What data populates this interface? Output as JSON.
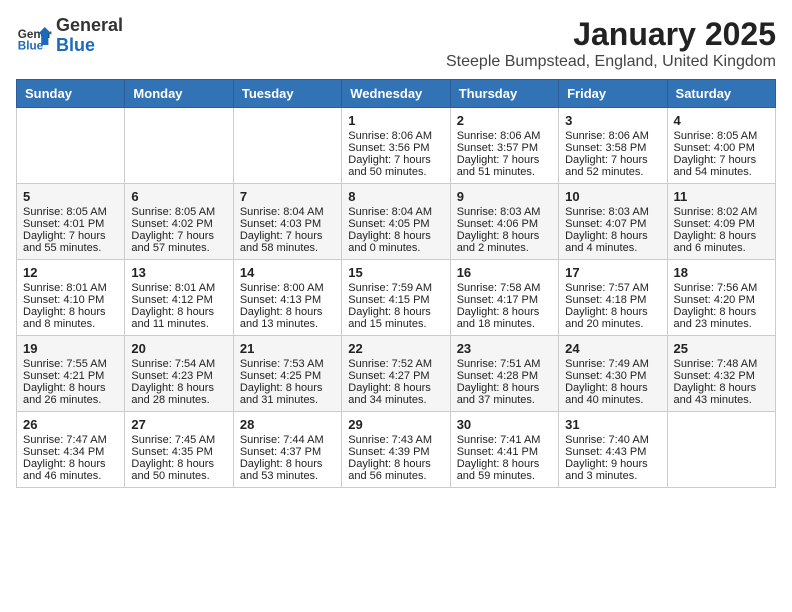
{
  "header": {
    "logo_general": "General",
    "logo_blue": "Blue",
    "month_title": "January 2025",
    "location": "Steeple Bumpstead, England, United Kingdom"
  },
  "weekdays": [
    "Sunday",
    "Monday",
    "Tuesday",
    "Wednesday",
    "Thursday",
    "Friday",
    "Saturday"
  ],
  "weeks": [
    [
      {
        "day": "",
        "info": ""
      },
      {
        "day": "",
        "info": ""
      },
      {
        "day": "",
        "info": ""
      },
      {
        "day": "1",
        "info": "Sunrise: 8:06 AM\nSunset: 3:56 PM\nDaylight: 7 hours and 50 minutes."
      },
      {
        "day": "2",
        "info": "Sunrise: 8:06 AM\nSunset: 3:57 PM\nDaylight: 7 hours and 51 minutes."
      },
      {
        "day": "3",
        "info": "Sunrise: 8:06 AM\nSunset: 3:58 PM\nDaylight: 7 hours and 52 minutes."
      },
      {
        "day": "4",
        "info": "Sunrise: 8:05 AM\nSunset: 4:00 PM\nDaylight: 7 hours and 54 minutes."
      }
    ],
    [
      {
        "day": "5",
        "info": "Sunrise: 8:05 AM\nSunset: 4:01 PM\nDaylight: 7 hours and 55 minutes."
      },
      {
        "day": "6",
        "info": "Sunrise: 8:05 AM\nSunset: 4:02 PM\nDaylight: 7 hours and 57 minutes."
      },
      {
        "day": "7",
        "info": "Sunrise: 8:04 AM\nSunset: 4:03 PM\nDaylight: 7 hours and 58 minutes."
      },
      {
        "day": "8",
        "info": "Sunrise: 8:04 AM\nSunset: 4:05 PM\nDaylight: 8 hours and 0 minutes."
      },
      {
        "day": "9",
        "info": "Sunrise: 8:03 AM\nSunset: 4:06 PM\nDaylight: 8 hours and 2 minutes."
      },
      {
        "day": "10",
        "info": "Sunrise: 8:03 AM\nSunset: 4:07 PM\nDaylight: 8 hours and 4 minutes."
      },
      {
        "day": "11",
        "info": "Sunrise: 8:02 AM\nSunset: 4:09 PM\nDaylight: 8 hours and 6 minutes."
      }
    ],
    [
      {
        "day": "12",
        "info": "Sunrise: 8:01 AM\nSunset: 4:10 PM\nDaylight: 8 hours and 8 minutes."
      },
      {
        "day": "13",
        "info": "Sunrise: 8:01 AM\nSunset: 4:12 PM\nDaylight: 8 hours and 11 minutes."
      },
      {
        "day": "14",
        "info": "Sunrise: 8:00 AM\nSunset: 4:13 PM\nDaylight: 8 hours and 13 minutes."
      },
      {
        "day": "15",
        "info": "Sunrise: 7:59 AM\nSunset: 4:15 PM\nDaylight: 8 hours and 15 minutes."
      },
      {
        "day": "16",
        "info": "Sunrise: 7:58 AM\nSunset: 4:17 PM\nDaylight: 8 hours and 18 minutes."
      },
      {
        "day": "17",
        "info": "Sunrise: 7:57 AM\nSunset: 4:18 PM\nDaylight: 8 hours and 20 minutes."
      },
      {
        "day": "18",
        "info": "Sunrise: 7:56 AM\nSunset: 4:20 PM\nDaylight: 8 hours and 23 minutes."
      }
    ],
    [
      {
        "day": "19",
        "info": "Sunrise: 7:55 AM\nSunset: 4:21 PM\nDaylight: 8 hours and 26 minutes."
      },
      {
        "day": "20",
        "info": "Sunrise: 7:54 AM\nSunset: 4:23 PM\nDaylight: 8 hours and 28 minutes."
      },
      {
        "day": "21",
        "info": "Sunrise: 7:53 AM\nSunset: 4:25 PM\nDaylight: 8 hours and 31 minutes."
      },
      {
        "day": "22",
        "info": "Sunrise: 7:52 AM\nSunset: 4:27 PM\nDaylight: 8 hours and 34 minutes."
      },
      {
        "day": "23",
        "info": "Sunrise: 7:51 AM\nSunset: 4:28 PM\nDaylight: 8 hours and 37 minutes."
      },
      {
        "day": "24",
        "info": "Sunrise: 7:49 AM\nSunset: 4:30 PM\nDaylight: 8 hours and 40 minutes."
      },
      {
        "day": "25",
        "info": "Sunrise: 7:48 AM\nSunset: 4:32 PM\nDaylight: 8 hours and 43 minutes."
      }
    ],
    [
      {
        "day": "26",
        "info": "Sunrise: 7:47 AM\nSunset: 4:34 PM\nDaylight: 8 hours and 46 minutes."
      },
      {
        "day": "27",
        "info": "Sunrise: 7:45 AM\nSunset: 4:35 PM\nDaylight: 8 hours and 50 minutes."
      },
      {
        "day": "28",
        "info": "Sunrise: 7:44 AM\nSunset: 4:37 PM\nDaylight: 8 hours and 53 minutes."
      },
      {
        "day": "29",
        "info": "Sunrise: 7:43 AM\nSunset: 4:39 PM\nDaylight: 8 hours and 56 minutes."
      },
      {
        "day": "30",
        "info": "Sunrise: 7:41 AM\nSunset: 4:41 PM\nDaylight: 8 hours and 59 minutes."
      },
      {
        "day": "31",
        "info": "Sunrise: 7:40 AM\nSunset: 4:43 PM\nDaylight: 9 hours and 3 minutes."
      },
      {
        "day": "",
        "info": ""
      }
    ]
  ]
}
